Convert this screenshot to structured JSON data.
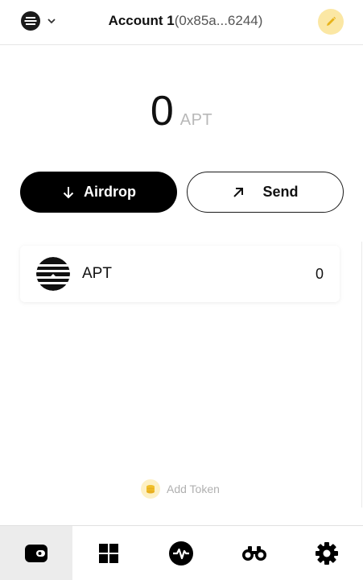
{
  "header": {
    "network_icon": "aptos-logo-icon",
    "account_name": "Account 1",
    "account_address": "(0x85a...6244)",
    "edit_icon": "pencil-icon"
  },
  "balance": {
    "value": "0",
    "unit": "APT"
  },
  "actions": {
    "airdrop_label": "Airdrop",
    "send_label": "Send"
  },
  "tokens": [
    {
      "symbol": "APT",
      "amount": "0",
      "icon": "aptos-logo-icon"
    }
  ],
  "add_token": {
    "label": "Add Token",
    "icon": "coins-icon"
  },
  "nav": {
    "items": [
      {
        "name": "wallet",
        "icon": "wallet-icon",
        "active": true
      },
      {
        "name": "collectibles",
        "icon": "grid-icon",
        "active": false
      },
      {
        "name": "activity",
        "icon": "activity-icon",
        "active": false
      },
      {
        "name": "explore",
        "icon": "binoculars-icon",
        "active": false
      },
      {
        "name": "settings",
        "icon": "gear-icon",
        "active": false
      }
    ]
  },
  "colors": {
    "primary": "#000000",
    "accent_yellow": "#fbe7a4",
    "muted_text": "#b8b8b8",
    "active_nav_bg": "#ececec"
  }
}
